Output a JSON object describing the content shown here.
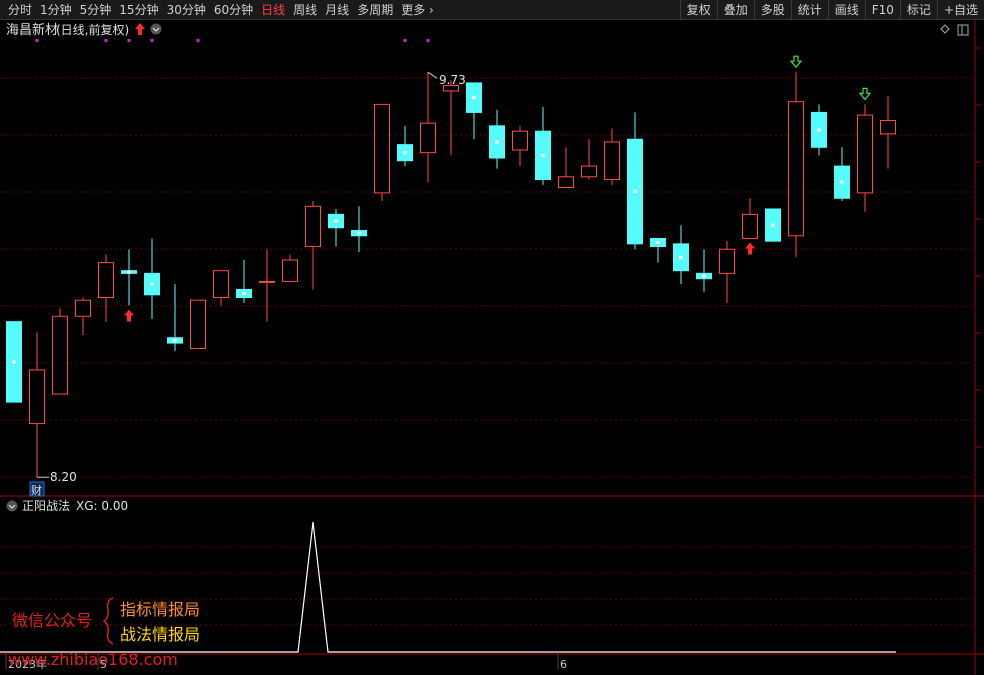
{
  "toolbar": {
    "periods": [
      "分时",
      "1分钟",
      "5分钟",
      "15分钟",
      "30分钟",
      "60分钟",
      "日线",
      "周线",
      "月线",
      "多周期",
      "更多 ›"
    ],
    "active_period": "日线",
    "tools": [
      "复权",
      "叠加",
      "多股",
      "统计",
      "画线",
      "F10",
      "标记",
      "+自选"
    ]
  },
  "stock_title": "海昌新材",
  "period_label": "(日线,前复权)",
  "indicator": {
    "name": "正阳战法",
    "label": "XG: 0.00"
  },
  "annotations": {
    "high_label": "9.73",
    "low_label": "8.20",
    "fin_label": "财"
  },
  "watermark": {
    "account_label": "微信公众号",
    "lines": [
      "指标情报局",
      "战法情报局"
    ],
    "url": "www.zhibiao168.com"
  },
  "xaxis": {
    "labels": [
      {
        "index": 0,
        "text": "2023年"
      },
      {
        "index": 4,
        "text": "5"
      },
      {
        "index": 24,
        "text": "6"
      }
    ]
  },
  "colors": {
    "up": "#ff4a4a",
    "down": "#54fcfc",
    "grid": "#6a0000",
    "border": "#a00000",
    "signal": "#ffffff"
  },
  "chart_data": [
    {
      "type": "candlestick",
      "title": "",
      "ylim": [
        8.15,
        9.85
      ],
      "candles": [
        {
          "open": 8.8,
          "high": 8.8,
          "low": 8.5,
          "close": 8.5
        },
        {
          "open": 8.42,
          "high": 8.76,
          "low": 8.22,
          "close": 8.62
        },
        {
          "open": 8.53,
          "high": 8.85,
          "low": 8.53,
          "close": 8.82
        },
        {
          "open": 8.82,
          "high": 8.89,
          "low": 8.75,
          "close": 8.88
        },
        {
          "open": 8.89,
          "high": 9.05,
          "low": 8.8,
          "close": 9.02
        },
        {
          "open": 8.99,
          "high": 9.07,
          "low": 8.86,
          "close": 8.98
        },
        {
          "open": 8.98,
          "high": 9.11,
          "low": 8.81,
          "close": 8.9
        },
        {
          "open": 8.74,
          "high": 8.94,
          "low": 8.69,
          "close": 8.72
        },
        {
          "open": 8.7,
          "high": 8.88,
          "low": 8.7,
          "close": 8.88
        },
        {
          "open": 8.89,
          "high": 8.98,
          "low": 8.86,
          "close": 8.99
        },
        {
          "open": 8.92,
          "high": 9.03,
          "low": 8.87,
          "close": 8.89
        },
        {
          "open": 8.95,
          "high": 9.07,
          "low": 8.8,
          "close": 8.95
        },
        {
          "open": 8.95,
          "high": 9.05,
          "low": 8.95,
          "close": 9.03
        },
        {
          "open": 9.08,
          "high": 9.25,
          "low": 8.92,
          "close": 9.23
        },
        {
          "open": 9.2,
          "high": 9.22,
          "low": 9.08,
          "close": 9.15
        },
        {
          "open": 9.14,
          "high": 9.23,
          "low": 9.06,
          "close": 9.12
        },
        {
          "open": 9.28,
          "high": 9.6,
          "low": 9.25,
          "close": 9.61
        },
        {
          "open": 9.46,
          "high": 9.53,
          "low": 9.38,
          "close": 9.4
        },
        {
          "open": 9.43,
          "high": 9.73,
          "low": 9.32,
          "close": 9.54
        },
        {
          "open": 9.66,
          "high": 9.7,
          "low": 9.42,
          "close": 9.68
        },
        {
          "open": 9.69,
          "high": 9.67,
          "low": 9.48,
          "close": 9.58
        },
        {
          "open": 9.53,
          "high": 9.59,
          "low": 9.37,
          "close": 9.41
        },
        {
          "open": 9.44,
          "high": 9.53,
          "low": 9.38,
          "close": 9.51
        },
        {
          "open": 9.51,
          "high": 9.6,
          "low": 9.31,
          "close": 9.33
        },
        {
          "open": 9.3,
          "high": 9.45,
          "low": 9.32,
          "close": 9.34
        },
        {
          "open": 9.34,
          "high": 9.48,
          "low": 9.33,
          "close": 9.38
        },
        {
          "open": 9.33,
          "high": 9.52,
          "low": 9.31,
          "close": 9.47
        },
        {
          "open": 9.48,
          "high": 9.58,
          "low": 9.07,
          "close": 9.09
        },
        {
          "open": 9.11,
          "high": 9.11,
          "low": 9.02,
          "close": 9.08
        },
        {
          "open": 9.09,
          "high": 9.16,
          "low": 8.94,
          "close": 8.99
        },
        {
          "open": 8.98,
          "high": 9.07,
          "low": 8.91,
          "close": 8.96
        },
        {
          "open": 8.98,
          "high": 9.1,
          "low": 8.87,
          "close": 9.07
        },
        {
          "open": 9.11,
          "high": 9.26,
          "low": 9.11,
          "close": 9.2
        },
        {
          "open": 9.22,
          "high": 9.22,
          "low": 9.1,
          "close": 9.1
        },
        {
          "open": 9.12,
          "high": 9.73,
          "low": 9.04,
          "close": 9.62
        },
        {
          "open": 9.58,
          "high": 9.61,
          "low": 9.42,
          "close": 9.45
        },
        {
          "open": 9.38,
          "high": 9.45,
          "low": 9.25,
          "close": 9.26
        },
        {
          "open": 9.28,
          "high": 9.61,
          "low": 9.21,
          "close": 9.57
        },
        {
          "open": 9.5,
          "high": 9.64,
          "low": 9.37,
          "close": 9.55
        }
      ],
      "marks": {
        "top_dots": [
          1,
          4,
          5,
          6,
          8,
          17,
          18
        ],
        "up_arrows": [
          5,
          32
        ],
        "down_arrows": [
          34,
          37
        ],
        "high_index": 18,
        "low_index": 1,
        "fin_index": 1
      }
    },
    {
      "type": "line",
      "title": "正阳战法",
      "series": [
        {
          "name": "XG",
          "values": [
            0,
            0,
            0,
            0,
            0,
            0,
            0,
            0,
            0,
            0,
            0,
            0,
            0,
            1,
            0,
            0,
            0,
            0,
            0,
            0,
            0,
            0,
            0,
            0,
            0,
            0,
            0,
            0,
            0,
            0,
            0,
            0,
            0,
            0,
            0,
            0,
            0,
            0,
            0
          ]
        }
      ],
      "ylim": [
        0,
        1
      ]
    }
  ]
}
